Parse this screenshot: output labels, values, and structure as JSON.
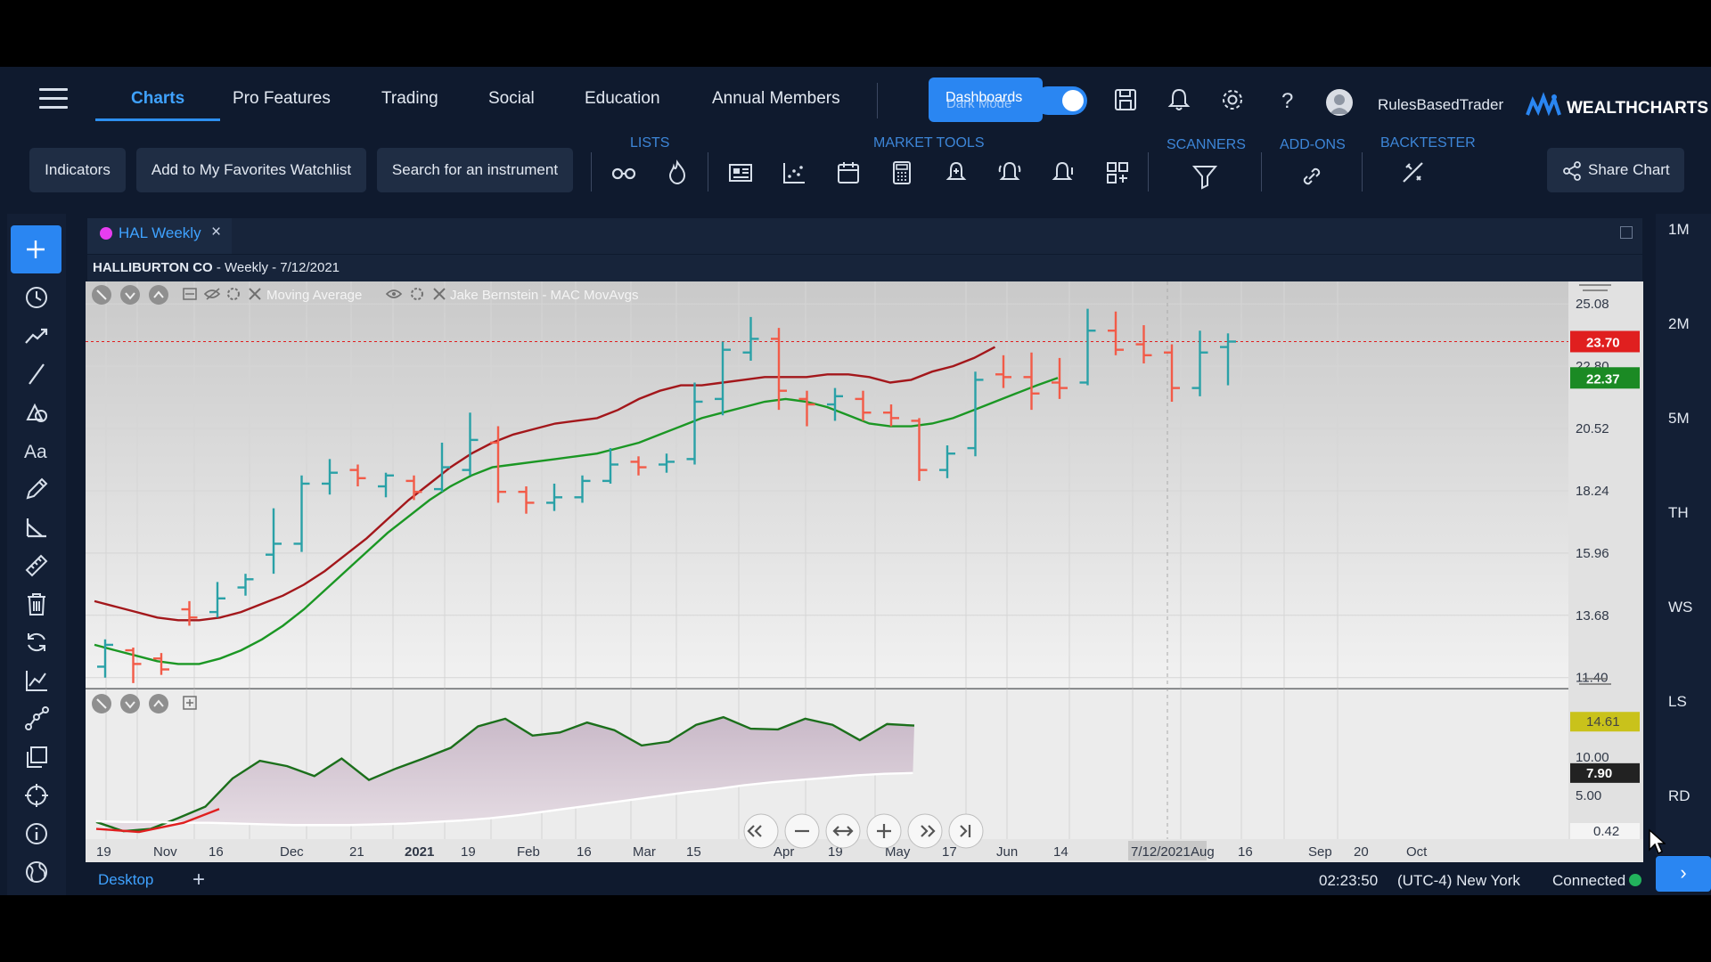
{
  "nav": {
    "items": [
      "Charts",
      "Pro Features",
      "Trading",
      "Social",
      "Education",
      "Annual Members"
    ],
    "active_index": 0,
    "dashboards_label": "Dashboards",
    "dark_mode_label": "Dark Mode",
    "username": "RulesBasedTrader",
    "brand": "WEALTHCHARTS"
  },
  "toolbar": {
    "indicators_label": "Indicators",
    "favorites_label": "Add to My Favorites Watchlist",
    "search_placeholder": "Search for an instrument",
    "groups": {
      "lists": "LISTS",
      "market_tools": "MARKET TOOLS",
      "scanners": "SCANNERS",
      "add_ons": "ADD-ONS",
      "backtester": "BACKTESTER"
    },
    "share_label": "Share Chart"
  },
  "chart_tab": {
    "label": "HAL Weekly",
    "dot_color": "#e73df0"
  },
  "chart_info": {
    "name": "HALLIBURTON CO",
    "detail": " - Weekly - 7/12/2021"
  },
  "indicator_labels": {
    "ma": "Moving Average",
    "mac": "Jake Bernstein - MAC MovAvgs"
  },
  "right_timeframes": [
    "1M",
    "2M",
    "5M",
    "TH",
    "WS",
    "LS",
    "RD"
  ],
  "footer": {
    "desktop_tab": "Desktop",
    "add_label": "+",
    "time": "02:23:50",
    "timezone": "(UTC-4) New York",
    "status": "Connected"
  },
  "colors": {
    "up_bar": "#2aa1a7",
    "down_bar": "#f25b48",
    "ma_fast": "#a3171b",
    "ma_slow": "#1b9724",
    "last_price": "#e01f1f",
    "accent": "#2a86f2"
  },
  "chart_data": {
    "type": "ohlc",
    "title": "HALLIBURTON CO - Weekly - 7/12/2021",
    "price_axis_ticks": [
      25.08,
      22.8,
      20.52,
      18.24,
      15.96,
      13.68,
      11.4
    ],
    "price_range": [
      11.0,
      25.9
    ],
    "last_price": 23.7,
    "ma_slow_value": 22.37,
    "x_tick_labels": [
      "19",
      "Nov",
      "16",
      "Dec",
      "21",
      "2021",
      "19",
      "Feb",
      "16",
      "Mar",
      "15",
      "Apr",
      "19",
      "May",
      "17",
      "Jun",
      "14",
      "7/12/2021",
      "Aug",
      "16",
      "Sep",
      "20",
      "Oct"
    ],
    "crosshair_date": "7/12/2021",
    "bars": [
      {
        "o": 11.8,
        "h": 12.8,
        "l": 11.4,
        "c": 12.6
      },
      {
        "o": 12.4,
        "h": 12.5,
        "l": 11.2,
        "c": 11.9
      },
      {
        "o": 12.1,
        "h": 12.3,
        "l": 11.5,
        "c": 11.7
      },
      {
        "o": 13.9,
        "h": 14.2,
        "l": 13.3,
        "c": 13.6
      },
      {
        "o": 13.8,
        "h": 14.9,
        "l": 13.6,
        "c": 14.3
      },
      {
        "o": 14.7,
        "h": 15.2,
        "l": 14.4,
        "c": 15.0
      },
      {
        "o": 15.9,
        "h": 17.6,
        "l": 15.2,
        "c": 16.3
      },
      {
        "o": 16.3,
        "h": 18.8,
        "l": 16.0,
        "c": 18.5
      },
      {
        "o": 18.5,
        "h": 19.4,
        "l": 18.1,
        "c": 18.9
      },
      {
        "o": 19.0,
        "h": 19.2,
        "l": 18.4,
        "c": 18.7
      },
      {
        "o": 18.4,
        "h": 18.9,
        "l": 18.0,
        "c": 18.8
      },
      {
        "o": 18.6,
        "h": 18.8,
        "l": 17.9,
        "c": 18.2
      },
      {
        "o": 18.3,
        "h": 20.0,
        "l": 18.2,
        "c": 19.1
      },
      {
        "o": 19.0,
        "h": 21.1,
        "l": 18.8,
        "c": 20.1
      },
      {
        "o": 20.0,
        "h": 20.6,
        "l": 17.8,
        "c": 18.2
      },
      {
        "o": 18.2,
        "h": 18.4,
        "l": 17.4,
        "c": 17.8
      },
      {
        "o": 17.8,
        "h": 18.5,
        "l": 17.5,
        "c": 18.0
      },
      {
        "o": 18.0,
        "h": 18.8,
        "l": 17.8,
        "c": 18.6
      },
      {
        "o": 18.6,
        "h": 19.8,
        "l": 18.5,
        "c": 19.2
      },
      {
        "o": 19.3,
        "h": 19.5,
        "l": 18.8,
        "c": 19.1
      },
      {
        "o": 19.2,
        "h": 19.6,
        "l": 18.9,
        "c": 19.3
      },
      {
        "o": 19.4,
        "h": 22.2,
        "l": 19.2,
        "c": 21.5
      },
      {
        "o": 21.6,
        "h": 23.7,
        "l": 21.0,
        "c": 23.4
      },
      {
        "o": 23.3,
        "h": 24.6,
        "l": 23.0,
        "c": 23.8
      },
      {
        "o": 23.8,
        "h": 24.2,
        "l": 21.2,
        "c": 21.9
      },
      {
        "o": 21.6,
        "h": 21.9,
        "l": 20.6,
        "c": 21.4
      },
      {
        "o": 21.4,
        "h": 22.0,
        "l": 20.8,
        "c": 21.7
      },
      {
        "o": 21.6,
        "h": 21.9,
        "l": 20.8,
        "c": 21.1
      },
      {
        "o": 21.1,
        "h": 21.4,
        "l": 20.6,
        "c": 20.9
      },
      {
        "o": 20.8,
        "h": 20.9,
        "l": 18.6,
        "c": 19.0
      },
      {
        "o": 19.0,
        "h": 19.9,
        "l": 18.7,
        "c": 19.6
      },
      {
        "o": 19.8,
        "h": 22.6,
        "l": 19.5,
        "c": 22.3
      },
      {
        "o": 22.5,
        "h": 23.2,
        "l": 22.0,
        "c": 22.4
      },
      {
        "o": 22.4,
        "h": 23.3,
        "l": 21.2,
        "c": 21.8
      },
      {
        "o": 22.2,
        "h": 23.1,
        "l": 21.6,
        "c": 22.0
      },
      {
        "o": 22.2,
        "h": 24.9,
        "l": 22.1,
        "c": 24.1
      },
      {
        "o": 24.1,
        "h": 24.8,
        "l": 23.2,
        "c": 23.4
      },
      {
        "o": 23.6,
        "h": 24.3,
        "l": 22.9,
        "c": 23.2
      },
      {
        "o": 23.3,
        "h": 23.6,
        "l": 21.5,
        "c": 22.0
      },
      {
        "o": 22.0,
        "h": 24.1,
        "l": 21.7,
        "c": 23.3
      },
      {
        "o": 23.5,
        "h": 24.0,
        "l": 22.1,
        "c": 23.7
      }
    ],
    "ma_fast": [
      14.2,
      14.0,
      13.8,
      13.6,
      13.5,
      13.5,
      13.6,
      13.8,
      14.1,
      14.4,
      14.8,
      15.3,
      15.9,
      16.5,
      17.2,
      17.9,
      18.5,
      19.1,
      19.6,
      20.0,
      20.3,
      20.5,
      20.7,
      20.8,
      20.9,
      21.2,
      21.6,
      21.9,
      22.1,
      22.1,
      22.2,
      22.3,
      22.4,
      22.4,
      22.4,
      22.5,
      22.5,
      22.4,
      22.2,
      22.3,
      22.6,
      22.8,
      23.1,
      23.5
    ],
    "ma_slow": [
      12.6,
      12.4,
      12.2,
      12.0,
      11.9,
      11.9,
      12.1,
      12.4,
      12.8,
      13.3,
      13.9,
      14.6,
      15.3,
      16.0,
      16.7,
      17.3,
      17.9,
      18.4,
      18.8,
      19.1,
      19.2,
      19.3,
      19.4,
      19.5,
      19.6,
      19.8,
      20.0,
      20.3,
      20.6,
      20.9,
      21.1,
      21.3,
      21.5,
      21.6,
      21.5,
      21.3,
      21.0,
      20.7,
      20.6,
      20.6,
      20.7,
      20.9,
      21.2,
      21.5,
      21.8,
      22.1,
      22.37
    ],
    "oscillator": {
      "axis_ticks": [
        10.0,
        5.0
      ],
      "range": [
        -0.5,
        16.5
      ],
      "last_osc": 14.61,
      "last_signal": 7.9,
      "axis_bottom": 0.42,
      "osc": [
        1.5,
        0.3,
        0.6,
        2.0,
        3.5,
        7.2,
        9.5,
        8.8,
        7.5,
        9.8,
        7.0,
        8.5,
        9.8,
        11.2,
        14.0,
        15.0,
        12.8,
        13.2,
        14.5,
        13.5,
        11.5,
        12.0,
        14.2,
        15.2,
        13.7,
        13.6,
        15.0,
        14.2,
        12.2,
        14.3,
        14.1
      ],
      "signal": [
        1.6,
        1.5,
        1.5,
        1.4,
        1.4,
        1.3,
        1.2,
        1.1,
        1.1,
        1.1,
        1.2,
        1.3,
        1.5,
        1.7,
        2.0,
        2.4,
        2.9,
        3.4,
        3.9,
        4.4,
        4.9,
        5.4,
        5.8,
        6.3,
        6.7,
        7.0,
        7.3,
        7.6,
        7.8,
        7.9
      ]
    }
  }
}
